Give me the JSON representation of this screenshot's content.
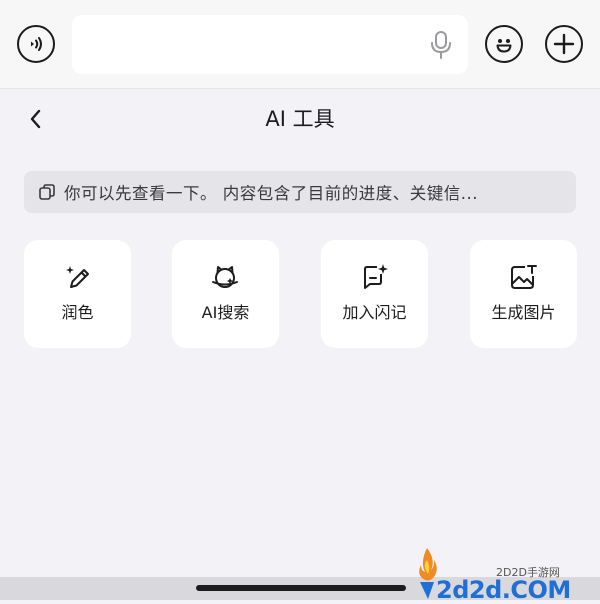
{
  "input_bar": {
    "value": "",
    "icons": [
      "voice-icon",
      "microphone-icon",
      "emoji-icon",
      "plus-icon"
    ]
  },
  "header": {
    "title": "AI 工具",
    "back_icon": "chevron-left-icon"
  },
  "quote": {
    "icon": "copy-icon",
    "text": "你可以先查看一下。 内容包含了目前的进度、关键信..."
  },
  "tools": [
    {
      "label": "润色",
      "icon": "magic-pen-icon"
    },
    {
      "label": "AI搜索",
      "icon": "ai-search-icon"
    },
    {
      "label": "加入闪记",
      "icon": "flash-note-icon"
    },
    {
      "label": "生成图片",
      "icon": "generate-image-icon"
    }
  ],
  "watermark": {
    "small_text": "2D2D手游网",
    "big_text": "2d2d.COM"
  },
  "colors": {
    "background": "#f2f2f7",
    "card": "#ffffff",
    "quote_bg": "#e4e4e9",
    "text": "#1c1c1e",
    "watermark_blue": "#1f6fd6"
  }
}
